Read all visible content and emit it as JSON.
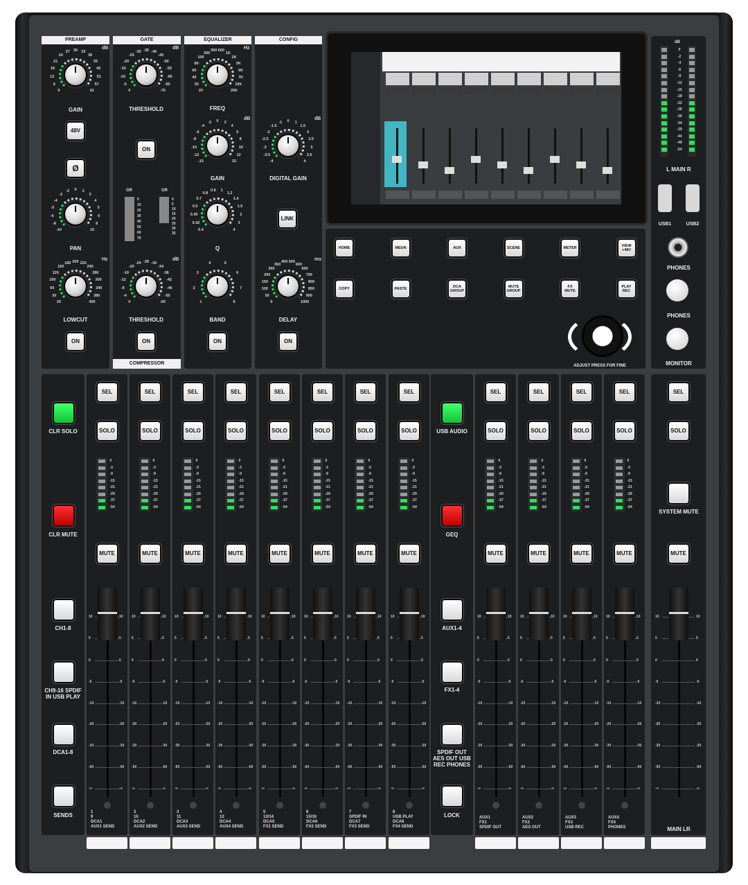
{
  "sections": {
    "preamp": "PREAMP",
    "gate": "GATE",
    "equalizer": "EQUALIZER",
    "config": "CONFIG",
    "compressor": "COMPRESSOR"
  },
  "knobs": {
    "gain": "GAIN",
    "threshold": "THRESHOLD",
    "freq": "FREQ",
    "eq_gain": "GAIN",
    "digital_gain": "DIGITAL GAIN",
    "pan": "PAN",
    "q": "Q",
    "lowcut": "LOWCUT",
    "comp_threshold": "THRESHOLD",
    "band": "BAND",
    "delay": "DELAY",
    "phones": "PHONES",
    "monitor": "MONITOR",
    "adjust": "ADJUST PRESS FOR FINE"
  },
  "units": {
    "db": "dB",
    "hz": "Hz",
    "ms": "ms"
  },
  "scales": {
    "gain": [
      "0",
      "6",
      "12",
      "18",
      "21",
      "24",
      "27",
      "30",
      "33",
      "36",
      "39",
      "45",
      "51",
      "57",
      "61"
    ],
    "threshold": [
      "0",
      "-5",
      "-10",
      "-15",
      "-20",
      "-25",
      "-30",
      "-35",
      "-40",
      "-45",
      "-50",
      "-55",
      "-60",
      "-65",
      "-75"
    ],
    "freq": [
      "20",
      "30",
      "40",
      "60",
      "80",
      "100",
      "200",
      "300",
      "600",
      "1K",
      "2K",
      "3K",
      "6K",
      "7K",
      "10K",
      "20K"
    ],
    "eq_gain": [
      "-15",
      "-12",
      "-10",
      "-8",
      "-6",
      "-4",
      "-2",
      "0",
      "2",
      "4",
      "6",
      "8",
      "10",
      "12",
      "15"
    ],
    "digital_gain": [
      "-4",
      "-3.5",
      "-3",
      "-2.5",
      "-2",
      "-1.5",
      "-1",
      "0",
      "1",
      "1.5",
      "2",
      "2.5",
      "3",
      "3.5",
      "4"
    ],
    "pan": [
      "-10",
      "-8",
      "-6",
      "-5",
      "-4",
      "-3",
      "-2",
      "0",
      "2",
      "3",
      "4",
      "5",
      "6",
      "8",
      "10"
    ],
    "q": [
      "0.4",
      "0.42",
      "0.45",
      "0.5",
      "0.7",
      "0.8",
      "0.9",
      "1",
      "1.2",
      "1.4",
      "1.5",
      "2",
      "3",
      "4"
    ],
    "lowcut": [
      "20",
      "30",
      "60",
      "100",
      "120",
      "160",
      "180",
      "200",
      "220",
      "240",
      "280",
      "300",
      "340",
      "380",
      "400"
    ],
    "comp_threshold": [
      "0",
      "-4",
      "-8",
      "-12",
      "-16",
      "-20",
      "-24",
      "-28",
      "-30",
      "-34",
      "-38",
      "-42",
      "-46",
      "-50",
      "-60"
    ],
    "band": [
      "1",
      "2",
      "3",
      "4",
      "5",
      "6",
      "7",
      "8"
    ],
    "delay": [
      "0",
      "50",
      "100",
      "150",
      "200",
      "300",
      "350",
      "400",
      "500",
      "600",
      "650",
      "700",
      "800",
      "850",
      "900",
      "1000"
    ],
    "gr": [
      "0",
      "10",
      "20",
      "30",
      "40",
      "50",
      "60",
      "70"
    ],
    "gr2": [
      "0",
      "5",
      "10",
      "15",
      "20",
      "25",
      "30",
      "35"
    ]
  },
  "gr_label": "GR",
  "buttons": {
    "v48": "48V",
    "phase": "Ø",
    "gate_on": "ON",
    "link": "LINK",
    "lowcut_on": "ON",
    "comp_on": "ON",
    "eq_on": "ON",
    "delay_on": "ON"
  },
  "nav": {
    "home": "HOME",
    "meun": "MEUN",
    "aux": "AUX",
    "scene": "SCENE",
    "meter": "METER",
    "view": "VIEW +48V",
    "copy": "COPY",
    "paste": "PASTE",
    "dca_group": "DCA GROUP",
    "mute_group": "MUTE GROUP",
    "fx_mute": "FX MUTE",
    "play_rec": "PLAY REC"
  },
  "main_meter": {
    "db": "dB",
    "scale": [
      "0",
      "-2",
      "-4",
      "-6",
      "-9",
      "-12",
      "-15",
      "-18",
      "-22",
      "-26",
      "-30",
      "-34",
      "-39",
      "-44",
      "-49",
      "-54"
    ],
    "label": "L MAIN R"
  },
  "usb": {
    "usb1": "USB1",
    "usb2": "USB2"
  },
  "left_col": {
    "clr_solo": "CLR SOLO",
    "clr_mute": "CLR MUTE",
    "ch18": "CH1-8",
    "ch916": "CH9-16 SPDIF IN USB PLAY",
    "dca": "DCA1-8",
    "sends": "SENDS"
  },
  "mid_col": {
    "usb_audio": "USB AUDIO",
    "geq": "GEQ",
    "aux14": "AUX1-4",
    "fx14": "FX1-4",
    "spdif": "SPDIF OUT AES OUT USB REC PHONES",
    "lock": "LOCK"
  },
  "right_col": {
    "system_mute": "SYSTEM MUTE",
    "main_lr": "MAIN LR"
  },
  "strip_buttons": {
    "sel": "SEL",
    "solo": "SOLO",
    "mute": "MUTE"
  },
  "strip_meter_scale": [
    "0",
    "-3",
    "-9",
    "-15",
    "-21",
    "-29",
    "-37",
    "-54"
  ],
  "fader_scale": [
    "10",
    "5",
    "0",
    "-5",
    "-10",
    "-20",
    "-30",
    "-50",
    "-∞"
  ],
  "channels": [
    {
      "l1": "1",
      "l2": "9",
      "l3": "DCA1",
      "l4": "AUX1 SEND"
    },
    {
      "l1": "2",
      "l2": "10",
      "l3": "DCA2",
      "l4": "AUX2 SEND"
    },
    {
      "l1": "3",
      "l2": "11",
      "l3": "DCA3",
      "l4": "AUX3 SEND"
    },
    {
      "l1": "4",
      "l2": "12",
      "l3": "DCA4",
      "l4": "AUX4 SEND"
    },
    {
      "l1": "5",
      "l2": "13/14",
      "l3": "DCA5",
      "l4": "FX1 SEND"
    },
    {
      "l1": "6",
      "l2": "15/16",
      "l3": "DCA6",
      "l4": "FX2 SEND"
    },
    {
      "l1": "7",
      "l2": "SPDIF IN",
      "l3": "DCA7",
      "l4": "FX3 SEND"
    },
    {
      "l1": "8",
      "l2": "USB PLAY",
      "l3": "DCA8",
      "l4": "FX4 SEND"
    }
  ],
  "aux_channels": [
    {
      "l1": "AUX1",
      "l2": "FX1",
      "l3": "SPDIF OUT"
    },
    {
      "l1": "AUX2",
      "l2": "FX2",
      "l3": "AES OUT"
    },
    {
      "l1": "AUX3",
      "l2": "FX3",
      "l3": "USB REC"
    },
    {
      "l1": "AUX4",
      "l2": "FX4",
      "l3": "PHONES"
    }
  ]
}
